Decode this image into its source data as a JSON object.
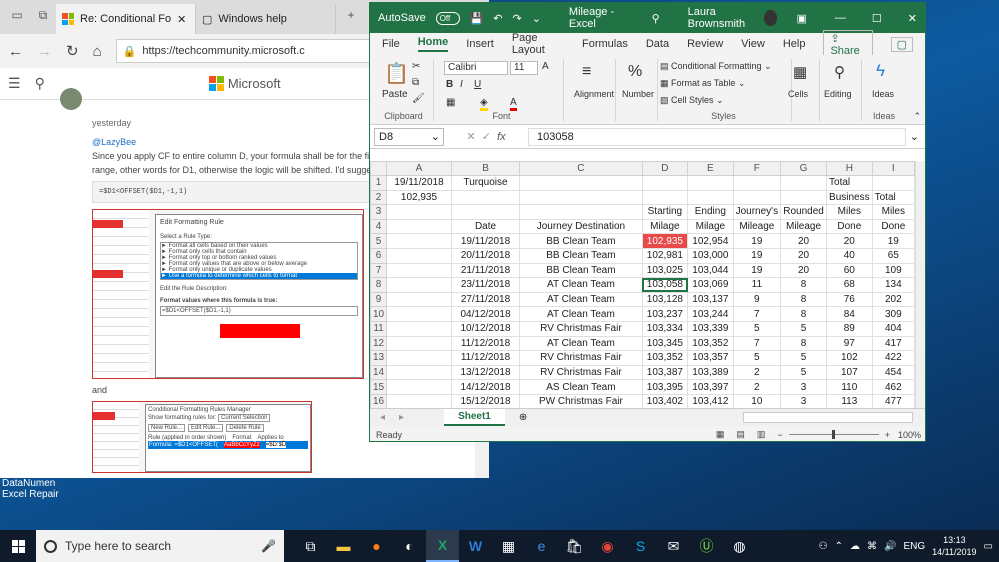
{
  "desktop": {
    "icon_label": "DataNumen\nExcel Repair",
    "edge_glyph": "E\n&"
  },
  "browser": {
    "tabs": [
      {
        "label": "Re: Conditional Fo"
      },
      {
        "label": "Windows help"
      }
    ],
    "url": "https://techcommunity.microsoft.c",
    "site_logo_text": "Microsoft",
    "post": {
      "time": "yesterday",
      "mention": "@LazyBee",
      "line1": "Since you apply CF to entire column D, your formula shall be for the first",
      "line2": "range, other words for D1, otherwise the logic will be shifted. I'd suggest",
      "code": "=$D1<OFFSET($D1,-1,1)",
      "and_text": "and",
      "dialog1": {
        "title": "Edit Formatting Rule",
        "select_label": "Select a Rule Type:",
        "rules": [
          "► Format all cells based on their values",
          "► Format only cells that contain",
          "► Format only top or bottom ranked values",
          "► Format only values that are above or below average",
          "► Format only unique or duplicate values",
          "► Use a formula to determine which cells to format"
        ],
        "edit_label": "Edit the Rule Description:",
        "formula_label": "Format values where this formula is true:",
        "formula": "=$D1<OFFSET($D1,-1,1)",
        "format_button": "Format..."
      },
      "dialog2": {
        "title": "Conditional Formatting Rules Manager",
        "show_label": "Show formatting rules for:",
        "show_value": "Current Selection",
        "buttons": [
          "New Rule...",
          "Edit Rule...",
          "Delete Rule"
        ],
        "cols": [
          "Rule (applied in order shown)",
          "Format",
          "Applies to"
        ],
        "rule": "Formula: =$D1<OFFSET(",
        "sample": "AaBbCcYyZz",
        "applies": "=$D:$D"
      }
    }
  },
  "excel": {
    "autosave": "AutoSave",
    "autosave_state": "Off",
    "title": "Mileage  -  Excel",
    "user": "Laura Brownsmith",
    "tabs": [
      "File",
      "Home",
      "Insert",
      "Page Layout",
      "Formulas",
      "Data",
      "Review",
      "View",
      "Help"
    ],
    "active_tab": "Home",
    "share": "Share",
    "ribbon": {
      "paste": "Paste",
      "clipboard": "Clipboard",
      "font_name": "Calibri",
      "font_size": "11",
      "font_group": "Font",
      "alignment": "Alignment",
      "number": "Number",
      "cond_format": "Conditional Formatting",
      "format_table": "Format as Table",
      "cell_styles": "Cell Styles",
      "styles": "Styles",
      "cells": "Cells",
      "editing": "Editing",
      "ideas": "Ideas",
      "ideas_group": "Ideas"
    },
    "name_box": "D8",
    "formula_value": "103058",
    "columns": [
      "A",
      "B",
      "C",
      "D",
      "E",
      "F",
      "G",
      "H",
      "I"
    ],
    "rows": [
      {
        "n": "1",
        "cells": [
          "19/11/2018",
          "Turquoise",
          "",
          "",
          "",
          "",
          "",
          "Total",
          ""
        ]
      },
      {
        "n": "2",
        "cells": [
          "102,935",
          "",
          "",
          "",
          "",
          "",
          "",
          "Business",
          "Total"
        ]
      },
      {
        "n": "3",
        "cells": [
          "",
          "",
          "",
          "Starting",
          "Ending",
          "Journey's",
          "Rounded",
          "Miles",
          "Miles"
        ]
      },
      {
        "n": "4",
        "cells": [
          "",
          "Date",
          "Journey Destination",
          "Milage",
          "Milage",
          "Mileage",
          "Mileage",
          "Done",
          "Done"
        ]
      },
      {
        "n": "5",
        "cells": [
          "",
          "19/11/2018",
          "BB Clean Team",
          "102,935",
          "102,954",
          "19",
          "20",
          "20",
          "19"
        ]
      },
      {
        "n": "6",
        "cells": [
          "",
          "20/11/2018",
          "BB Clean Team",
          "102,981",
          "103,000",
          "19",
          "20",
          "40",
          "65"
        ]
      },
      {
        "n": "7",
        "cells": [
          "",
          "21/11/2018",
          "BB Clean Team",
          "103,025",
          "103,044",
          "19",
          "20",
          "60",
          "109"
        ]
      },
      {
        "n": "8",
        "cells": [
          "",
          "23/11/2018",
          "AT Clean Team",
          "103,058",
          "103,069",
          "11",
          "8",
          "68",
          "134"
        ]
      },
      {
        "n": "9",
        "cells": [
          "",
          "27/11/2018",
          "AT Clean Team",
          "103,128",
          "103,137",
          "9",
          "8",
          "76",
          "202"
        ]
      },
      {
        "n": "10",
        "cells": [
          "",
          "04/12/2018",
          "AT Clean Team",
          "103,237",
          "103,244",
          "7",
          "8",
          "84",
          "309"
        ]
      },
      {
        "n": "11",
        "cells": [
          "",
          "10/12/2018",
          "RV Christmas Fair",
          "103,334",
          "103,339",
          "5",
          "5",
          "89",
          "404"
        ]
      },
      {
        "n": "12",
        "cells": [
          "",
          "11/12/2018",
          "AT Clean Team",
          "103,345",
          "103,352",
          "7",
          "8",
          "97",
          "417"
        ]
      },
      {
        "n": "13",
        "cells": [
          "",
          "11/12/2018",
          "RV Christmas Fair",
          "103,352",
          "103,357",
          "5",
          "5",
          "102",
          "422"
        ]
      },
      {
        "n": "14",
        "cells": [
          "",
          "13/12/2018",
          "RV Christmas Fair",
          "103,387",
          "103,389",
          "2",
          "5",
          "107",
          "454"
        ]
      },
      {
        "n": "15",
        "cells": [
          "",
          "14/12/2018",
          "AS Clean Team",
          "103,395",
          "103,397",
          "2",
          "3",
          "110",
          "462"
        ]
      },
      {
        "n": "16",
        "cells": [
          "",
          "15/12/2018",
          "PW Christmas Fair",
          "103,402",
          "103,412",
          "10",
          "3",
          "113",
          "477"
        ]
      }
    ],
    "sheet_tab": "Sheet1",
    "status": "Ready",
    "zoom": "100%",
    "highlight_color": "#e84a4a"
  },
  "taskbar": {
    "search_placeholder": "Type here to search",
    "language": "ENG",
    "time": "13:13",
    "date": "14/11/2019"
  }
}
